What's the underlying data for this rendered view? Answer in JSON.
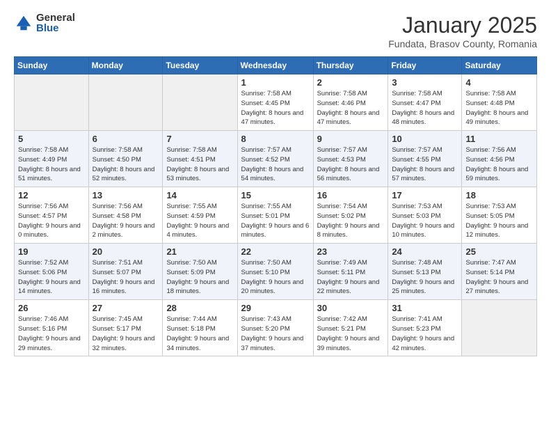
{
  "logo": {
    "general": "General",
    "blue": "Blue"
  },
  "header": {
    "title": "January 2025",
    "location": "Fundata, Brasov County, Romania"
  },
  "weekdays": [
    "Sunday",
    "Monday",
    "Tuesday",
    "Wednesday",
    "Thursday",
    "Friday",
    "Saturday"
  ],
  "weeks": [
    [
      {
        "day": "",
        "info": ""
      },
      {
        "day": "",
        "info": ""
      },
      {
        "day": "",
        "info": ""
      },
      {
        "day": "1",
        "info": "Sunrise: 7:58 AM\nSunset: 4:45 PM\nDaylight: 8 hours\nand 47 minutes."
      },
      {
        "day": "2",
        "info": "Sunrise: 7:58 AM\nSunset: 4:46 PM\nDaylight: 8 hours\nand 47 minutes."
      },
      {
        "day": "3",
        "info": "Sunrise: 7:58 AM\nSunset: 4:47 PM\nDaylight: 8 hours\nand 48 minutes."
      },
      {
        "day": "4",
        "info": "Sunrise: 7:58 AM\nSunset: 4:48 PM\nDaylight: 8 hours\nand 49 minutes."
      }
    ],
    [
      {
        "day": "5",
        "info": "Sunrise: 7:58 AM\nSunset: 4:49 PM\nDaylight: 8 hours\nand 51 minutes."
      },
      {
        "day": "6",
        "info": "Sunrise: 7:58 AM\nSunset: 4:50 PM\nDaylight: 8 hours\nand 52 minutes."
      },
      {
        "day": "7",
        "info": "Sunrise: 7:58 AM\nSunset: 4:51 PM\nDaylight: 8 hours\nand 53 minutes."
      },
      {
        "day": "8",
        "info": "Sunrise: 7:57 AM\nSunset: 4:52 PM\nDaylight: 8 hours\nand 54 minutes."
      },
      {
        "day": "9",
        "info": "Sunrise: 7:57 AM\nSunset: 4:53 PM\nDaylight: 8 hours\nand 56 minutes."
      },
      {
        "day": "10",
        "info": "Sunrise: 7:57 AM\nSunset: 4:55 PM\nDaylight: 8 hours\nand 57 minutes."
      },
      {
        "day": "11",
        "info": "Sunrise: 7:56 AM\nSunset: 4:56 PM\nDaylight: 8 hours\nand 59 minutes."
      }
    ],
    [
      {
        "day": "12",
        "info": "Sunrise: 7:56 AM\nSunset: 4:57 PM\nDaylight: 9 hours\nand 0 minutes."
      },
      {
        "day": "13",
        "info": "Sunrise: 7:56 AM\nSunset: 4:58 PM\nDaylight: 9 hours\nand 2 minutes."
      },
      {
        "day": "14",
        "info": "Sunrise: 7:55 AM\nSunset: 4:59 PM\nDaylight: 9 hours\nand 4 minutes."
      },
      {
        "day": "15",
        "info": "Sunrise: 7:55 AM\nSunset: 5:01 PM\nDaylight: 9 hours\nand 6 minutes."
      },
      {
        "day": "16",
        "info": "Sunrise: 7:54 AM\nSunset: 5:02 PM\nDaylight: 9 hours\nand 8 minutes."
      },
      {
        "day": "17",
        "info": "Sunrise: 7:53 AM\nSunset: 5:03 PM\nDaylight: 9 hours\nand 10 minutes."
      },
      {
        "day": "18",
        "info": "Sunrise: 7:53 AM\nSunset: 5:05 PM\nDaylight: 9 hours\nand 12 minutes."
      }
    ],
    [
      {
        "day": "19",
        "info": "Sunrise: 7:52 AM\nSunset: 5:06 PM\nDaylight: 9 hours\nand 14 minutes."
      },
      {
        "day": "20",
        "info": "Sunrise: 7:51 AM\nSunset: 5:07 PM\nDaylight: 9 hours\nand 16 minutes."
      },
      {
        "day": "21",
        "info": "Sunrise: 7:50 AM\nSunset: 5:09 PM\nDaylight: 9 hours\nand 18 minutes."
      },
      {
        "day": "22",
        "info": "Sunrise: 7:50 AM\nSunset: 5:10 PM\nDaylight: 9 hours\nand 20 minutes."
      },
      {
        "day": "23",
        "info": "Sunrise: 7:49 AM\nSunset: 5:11 PM\nDaylight: 9 hours\nand 22 minutes."
      },
      {
        "day": "24",
        "info": "Sunrise: 7:48 AM\nSunset: 5:13 PM\nDaylight: 9 hours\nand 25 minutes."
      },
      {
        "day": "25",
        "info": "Sunrise: 7:47 AM\nSunset: 5:14 PM\nDaylight: 9 hours\nand 27 minutes."
      }
    ],
    [
      {
        "day": "26",
        "info": "Sunrise: 7:46 AM\nSunset: 5:16 PM\nDaylight: 9 hours\nand 29 minutes."
      },
      {
        "day": "27",
        "info": "Sunrise: 7:45 AM\nSunset: 5:17 PM\nDaylight: 9 hours\nand 32 minutes."
      },
      {
        "day": "28",
        "info": "Sunrise: 7:44 AM\nSunset: 5:18 PM\nDaylight: 9 hours\nand 34 minutes."
      },
      {
        "day": "29",
        "info": "Sunrise: 7:43 AM\nSunset: 5:20 PM\nDaylight: 9 hours\nand 37 minutes."
      },
      {
        "day": "30",
        "info": "Sunrise: 7:42 AM\nSunset: 5:21 PM\nDaylight: 9 hours\nand 39 minutes."
      },
      {
        "day": "31",
        "info": "Sunrise: 7:41 AM\nSunset: 5:23 PM\nDaylight: 9 hours\nand 42 minutes."
      },
      {
        "day": "",
        "info": ""
      }
    ]
  ]
}
